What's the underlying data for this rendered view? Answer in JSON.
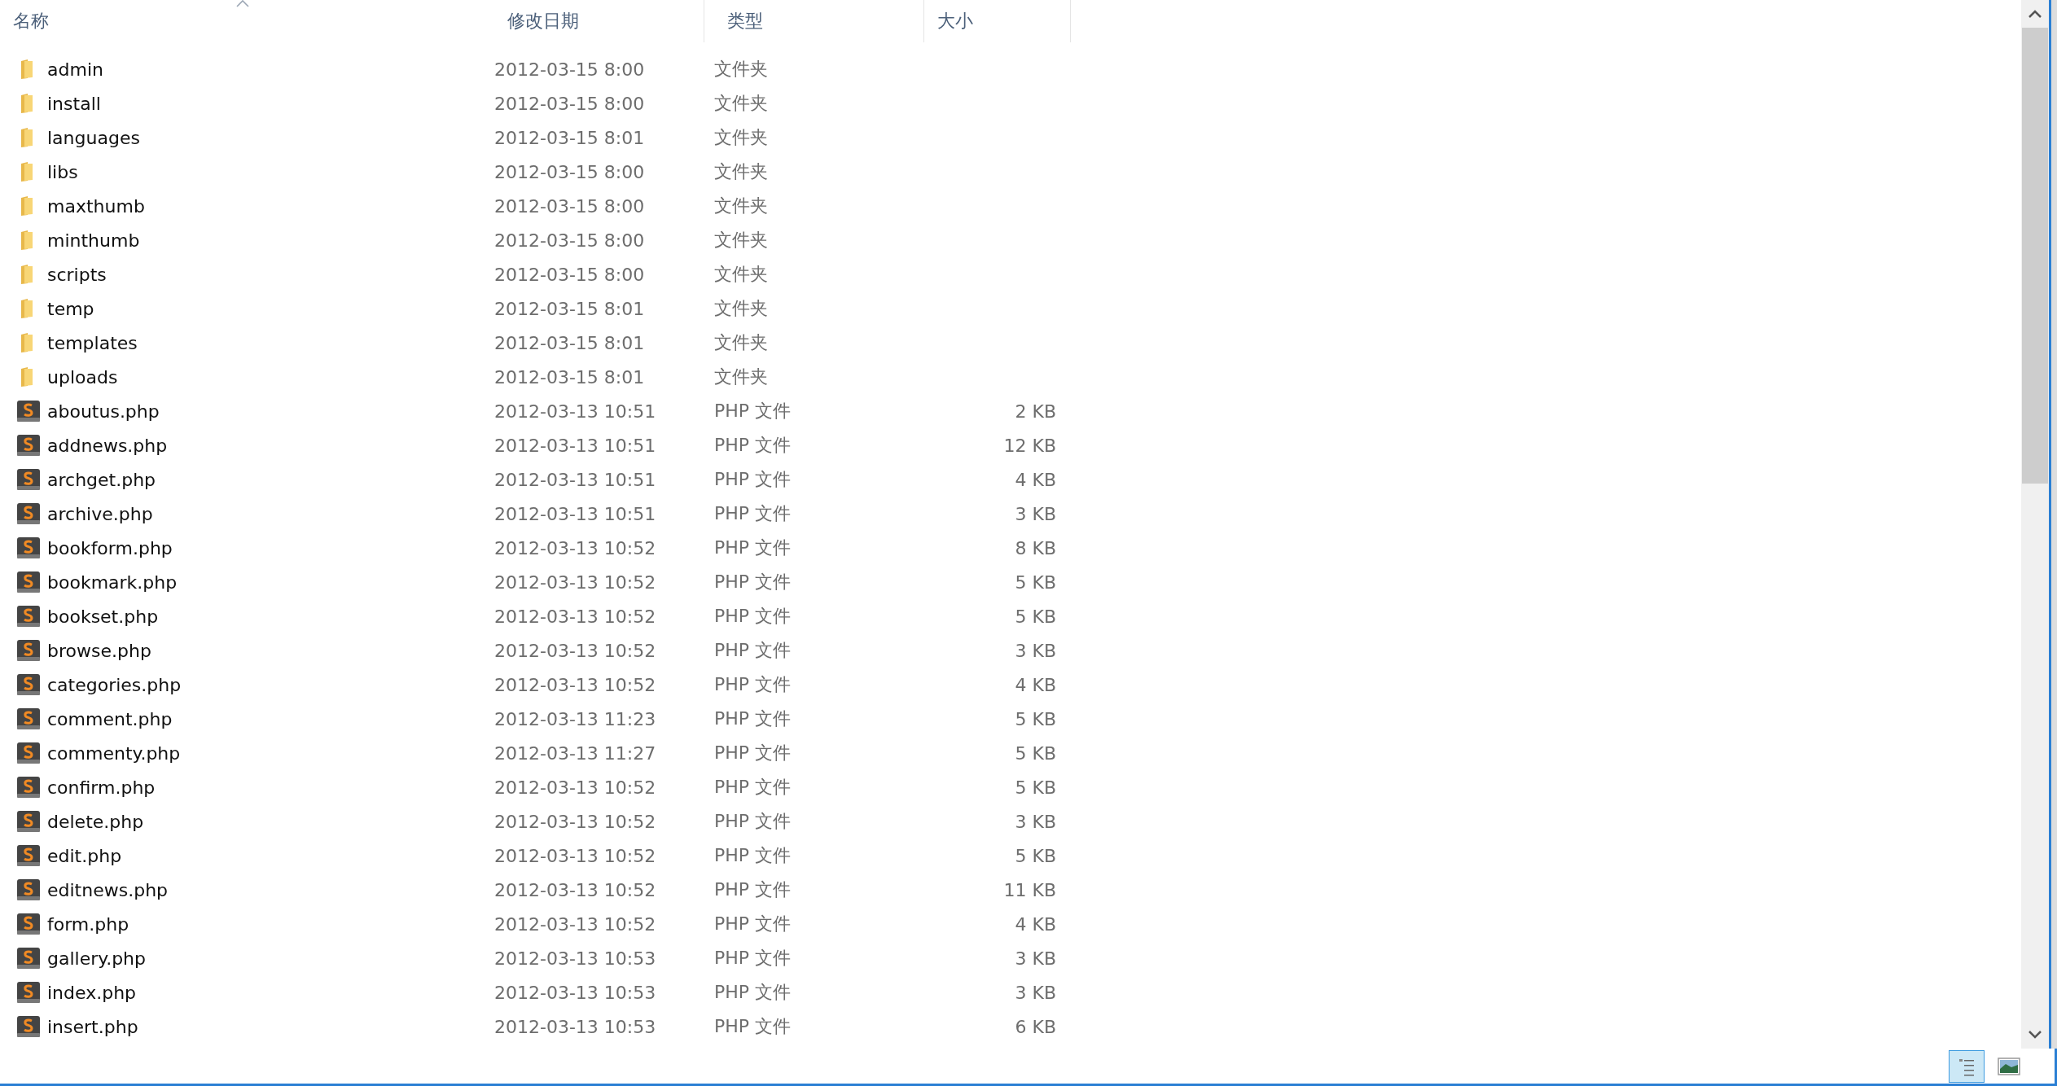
{
  "columns": [
    {
      "label": "名称",
      "sorted": true
    },
    {
      "label": "修改日期",
      "sorted": false
    },
    {
      "label": "类型",
      "sorted": false
    },
    {
      "label": "大小",
      "sorted": false
    }
  ],
  "rows": [
    {
      "kind": "folder",
      "name": "admin",
      "date": "2012-03-15 8:00",
      "type": "文件夹"
    },
    {
      "kind": "folder",
      "name": "install",
      "date": "2012-03-15 8:00",
      "type": "文件夹"
    },
    {
      "kind": "folder",
      "name": "languages",
      "date": "2012-03-15 8:01",
      "type": "文件夹"
    },
    {
      "kind": "folder",
      "name": "libs",
      "date": "2012-03-15 8:00",
      "type": "文件夹"
    },
    {
      "kind": "folder",
      "name": "maxthumb",
      "date": "2012-03-15 8:00",
      "type": "文件夹"
    },
    {
      "kind": "folder",
      "name": "minthumb",
      "date": "2012-03-15 8:00",
      "type": "文件夹"
    },
    {
      "kind": "folder",
      "name": "scripts",
      "date": "2012-03-15 8:00",
      "type": "文件夹"
    },
    {
      "kind": "folder",
      "name": "temp",
      "date": "2012-03-15 8:01",
      "type": "文件夹"
    },
    {
      "kind": "folder",
      "name": "templates",
      "date": "2012-03-15 8:01",
      "type": "文件夹"
    },
    {
      "kind": "folder",
      "name": "uploads",
      "date": "2012-03-15 8:01",
      "type": "文件夹"
    },
    {
      "kind": "php",
      "name": "aboutus.php",
      "date": "2012-03-13 10:51",
      "type": "PHP 文件",
      "size": "2 KB"
    },
    {
      "kind": "php",
      "name": "addnews.php",
      "date": "2012-03-13 10:51",
      "type": "PHP 文件",
      "size": "12 KB"
    },
    {
      "kind": "php",
      "name": "archget.php",
      "date": "2012-03-13 10:51",
      "type": "PHP 文件",
      "size": "4 KB"
    },
    {
      "kind": "php",
      "name": "archive.php",
      "date": "2012-03-13 10:51",
      "type": "PHP 文件",
      "size": "3 KB"
    },
    {
      "kind": "php",
      "name": "bookform.php",
      "date": "2012-03-13 10:52",
      "type": "PHP 文件",
      "size": "8 KB"
    },
    {
      "kind": "php",
      "name": "bookmark.php",
      "date": "2012-03-13 10:52",
      "type": "PHP 文件",
      "size": "5 KB"
    },
    {
      "kind": "php",
      "name": "bookset.php",
      "date": "2012-03-13 10:52",
      "type": "PHP 文件",
      "size": "5 KB"
    },
    {
      "kind": "php",
      "name": "browse.php",
      "date": "2012-03-13 10:52",
      "type": "PHP 文件",
      "size": "3 KB"
    },
    {
      "kind": "php",
      "name": "categories.php",
      "date": "2012-03-13 10:52",
      "type": "PHP 文件",
      "size": "4 KB"
    },
    {
      "kind": "php",
      "name": "comment.php",
      "date": "2012-03-13 11:23",
      "type": "PHP 文件",
      "size": "5 KB"
    },
    {
      "kind": "php",
      "name": "commenty.php",
      "date": "2012-03-13 11:27",
      "type": "PHP 文件",
      "size": "5 KB"
    },
    {
      "kind": "php",
      "name": "confirm.php",
      "date": "2012-03-13 10:52",
      "type": "PHP 文件",
      "size": "5 KB"
    },
    {
      "kind": "php",
      "name": "delete.php",
      "date": "2012-03-13 10:52",
      "type": "PHP 文件",
      "size": "3 KB"
    },
    {
      "kind": "php",
      "name": "edit.php",
      "date": "2012-03-13 10:52",
      "type": "PHP 文件",
      "size": "5 KB"
    },
    {
      "kind": "php",
      "name": "editnews.php",
      "date": "2012-03-13 10:52",
      "type": "PHP 文件",
      "size": "11 KB"
    },
    {
      "kind": "php",
      "name": "form.php",
      "date": "2012-03-13 10:52",
      "type": "PHP 文件",
      "size": "4 KB"
    },
    {
      "kind": "php",
      "name": "gallery.php",
      "date": "2012-03-13 10:53",
      "type": "PHP 文件",
      "size": "3 KB"
    },
    {
      "kind": "php",
      "name": "index.php",
      "date": "2012-03-13 10:53",
      "type": "PHP 文件",
      "size": "3 KB"
    },
    {
      "kind": "php",
      "name": "insert.php",
      "date": "2012-03-13 10:53",
      "type": "PHP 文件",
      "size": "6 KB"
    }
  ],
  "view_buttons": [
    {
      "kind": "details",
      "selected": true
    },
    {
      "kind": "large_icons",
      "selected": false
    }
  ]
}
